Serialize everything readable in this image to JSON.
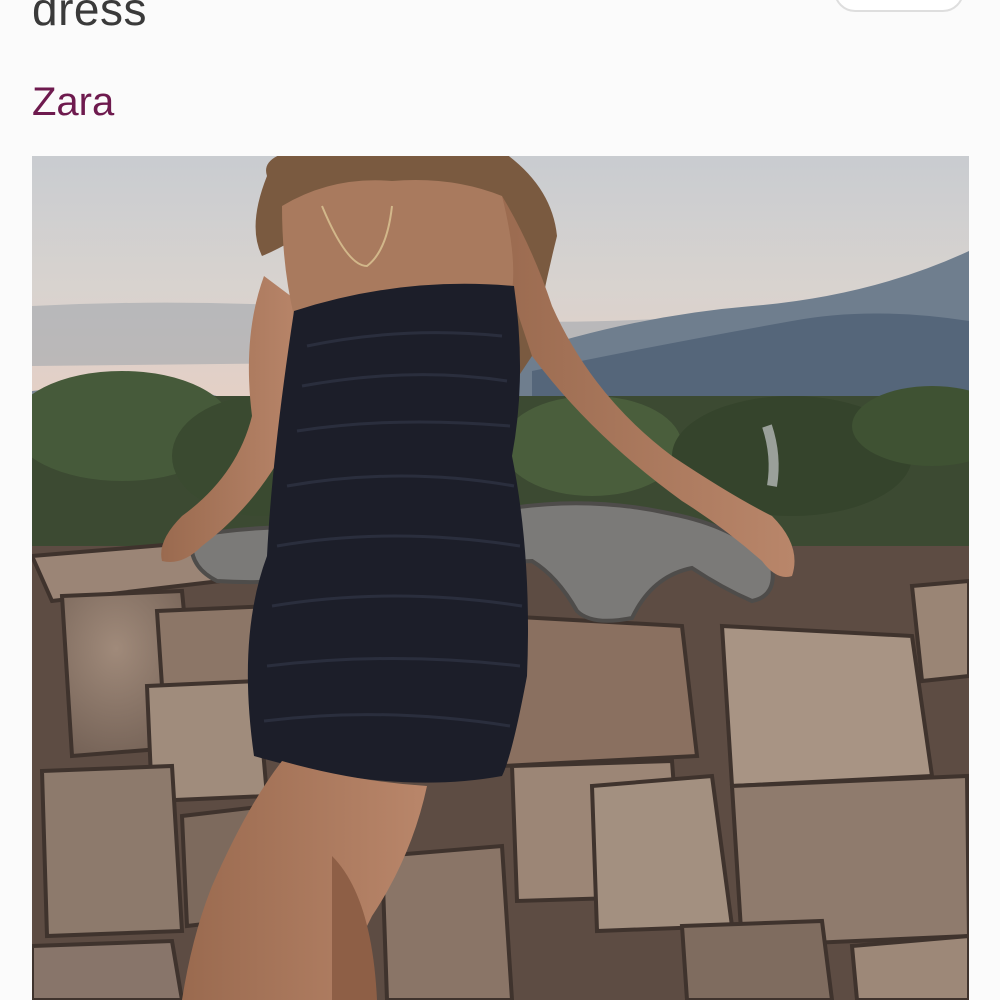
{
  "product": {
    "title": "dress",
    "brand": "Zara"
  },
  "colors": {
    "background": "#fbfbfb",
    "title": "#3a3a3a",
    "brand": "#6e1a4e"
  }
}
